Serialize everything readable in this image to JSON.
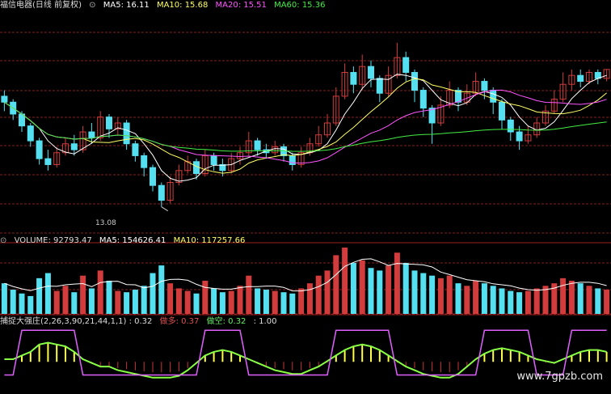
{
  "colors": {
    "background": "#000000",
    "up": "#d23c3c",
    "down": "#54e0f0",
    "grid": "#8a1e1e",
    "ma5": "#ffffff",
    "ma10": "#ffff66",
    "ma20": "#ff55ff",
    "ma60": "#44ee44",
    "ind_line": "#e060ff",
    "ind_bar_up": "#ffff44",
    "ind_bar_dn": "#cc3333",
    "ind_curve": "#88ff44"
  },
  "price_panel": {
    "title": "福信电器(日线 前复权)",
    "icon": "circle-settings-icon",
    "ma5": "MA5: 16.11",
    "ma10": "MA10: 15.68",
    "ma20": "MA20: 15.51",
    "ma60": "MA60: 15.36",
    "low_label": "13.08"
  },
  "volume_panel": {
    "volume": "VOLUME: 92793.47",
    "ma5": "MA5: 154626.41",
    "ma10": "MA10: 117257.66"
  },
  "indicator_panel": {
    "name": "捕捉大强庄(2,26,3,90,21,44,1,1) : 0.32",
    "long_label": "做多: 0.37",
    "short_label": "做空: 0.32",
    "extra": ": 1.00"
  },
  "watermark": "www.7gpzb.com",
  "chart_data": {
    "type": "candlestick",
    "price_ylim": [
      12.2,
      19.6
    ],
    "volume_ylim": [
      0,
      260000
    ],
    "candles": [
      [
        16.8,
        16.6,
        17.0,
        16.3
      ],
      [
        16.6,
        16.2,
        16.7,
        16.0
      ],
      [
        16.2,
        15.8,
        16.3,
        15.6
      ],
      [
        15.8,
        15.3,
        15.9,
        15.1
      ],
      [
        15.3,
        14.7,
        15.4,
        14.5
      ],
      [
        14.7,
        14.5,
        15.0,
        14.3
      ],
      [
        14.5,
        14.9,
        15.1,
        14.4
      ],
      [
        14.9,
        15.2,
        15.4,
        14.8
      ],
      [
        15.2,
        15.0,
        15.5,
        14.8
      ],
      [
        15.0,
        15.6,
        15.8,
        14.9
      ],
      [
        15.6,
        15.4,
        15.9,
        15.2
      ],
      [
        15.4,
        16.1,
        16.3,
        15.3
      ],
      [
        16.1,
        15.7,
        16.2,
        15.4
      ],
      [
        15.7,
        15.9,
        16.1,
        15.5
      ],
      [
        15.9,
        15.2,
        16.0,
        15.0
      ],
      [
        15.2,
        14.8,
        15.3,
        14.6
      ],
      [
        14.8,
        14.4,
        14.9,
        14.1
      ],
      [
        14.4,
        13.8,
        14.5,
        13.6
      ],
      [
        13.8,
        13.3,
        13.9,
        13.08
      ],
      [
        13.3,
        13.9,
        14.1,
        13.2
      ],
      [
        13.9,
        14.3,
        14.5,
        13.8
      ],
      [
        14.3,
        14.6,
        14.8,
        14.2
      ],
      [
        14.6,
        14.2,
        14.7,
        14.0
      ],
      [
        14.2,
        14.8,
        15.0,
        14.1
      ],
      [
        14.8,
        14.5,
        14.9,
        14.3
      ],
      [
        14.5,
        14.3,
        14.7,
        14.1
      ],
      [
        14.3,
        14.7,
        14.9,
        14.2
      ],
      [
        14.7,
        14.9,
        15.1,
        14.5
      ],
      [
        14.9,
        15.3,
        15.6,
        14.8
      ],
      [
        15.3,
        15.0,
        15.4,
        14.8
      ],
      [
        15.0,
        14.9,
        15.2,
        14.7
      ],
      [
        14.9,
        15.1,
        15.3,
        14.8
      ],
      [
        15.1,
        14.8,
        15.2,
        14.6
      ],
      [
        14.8,
        14.5,
        14.9,
        14.3
      ],
      [
        14.5,
        14.9,
        15.1,
        14.4
      ],
      [
        14.9,
        15.2,
        15.4,
        14.8
      ],
      [
        15.2,
        15.5,
        15.8,
        15.1
      ],
      [
        15.5,
        15.9,
        16.2,
        15.4
      ],
      [
        15.9,
        16.8,
        17.1,
        15.8
      ],
      [
        16.8,
        17.6,
        17.9,
        16.7
      ],
      [
        17.6,
        17.2,
        17.8,
        16.9
      ],
      [
        17.2,
        17.8,
        18.2,
        17.0
      ],
      [
        17.8,
        17.4,
        18.0,
        17.1
      ],
      [
        17.4,
        16.9,
        17.5,
        16.6
      ],
      [
        16.9,
        17.5,
        17.8,
        16.8
      ],
      [
        17.5,
        18.1,
        18.6,
        17.4
      ],
      [
        18.1,
        17.6,
        18.3,
        17.3
      ],
      [
        17.6,
        17.0,
        17.7,
        16.6
      ],
      [
        17.0,
        16.4,
        17.1,
        16.1
      ],
      [
        16.4,
        15.9,
        16.5,
        15.2
      ],
      [
        15.9,
        16.5,
        16.8,
        15.8
      ],
      [
        16.5,
        17.0,
        17.3,
        16.4
      ],
      [
        17.0,
        16.6,
        17.1,
        16.3
      ],
      [
        16.6,
        16.9,
        17.2,
        16.5
      ],
      [
        16.9,
        17.3,
        17.6,
        16.8
      ],
      [
        17.3,
        17.0,
        17.4,
        16.7
      ],
      [
        17.0,
        16.6,
        17.1,
        16.2
      ],
      [
        16.6,
        16.0,
        16.7,
        15.7
      ],
      [
        16.0,
        15.6,
        16.1,
        15.3
      ],
      [
        15.6,
        15.3,
        15.8,
        15.0
      ],
      [
        15.3,
        15.5,
        15.8,
        15.2
      ],
      [
        15.5,
        15.9,
        16.1,
        15.4
      ],
      [
        15.9,
        16.3,
        16.5,
        15.8
      ],
      [
        16.3,
        16.7,
        17.0,
        16.2
      ],
      [
        16.7,
        17.2,
        17.6,
        16.6
      ],
      [
        17.2,
        17.5,
        17.7,
        17.0
      ],
      [
        17.5,
        17.3,
        17.7,
        17.1
      ],
      [
        17.3,
        17.6,
        17.7,
        17.2
      ],
      [
        17.6,
        17.4,
        17.7,
        17.2
      ],
      [
        17.4,
        17.7,
        17.7,
        17.3
      ]
    ],
    "volume": [
      120,
      95,
      80,
      70,
      140,
      160,
      90,
      110,
      85,
      150,
      100,
      170,
      130,
      90,
      85,
      95,
      110,
      160,
      190,
      120,
      100,
      90,
      80,
      130,
      100,
      85,
      90,
      110,
      150,
      100,
      95,
      90,
      85,
      80,
      100,
      120,
      150,
      170,
      230,
      260,
      200,
      210,
      180,
      170,
      190,
      240,
      200,
      170,
      160,
      150,
      140,
      150,
      120,
      110,
      130,
      120,
      110,
      100,
      90,
      85,
      90,
      100,
      110,
      120,
      140,
      130,
      120,
      110,
      100,
      95
    ],
    "indicator": {
      "range": [
        0,
        1
      ],
      "values": [
        0.5,
        0.5,
        0.6,
        0.7,
        0.9,
        0.95,
        0.9,
        0.85,
        0.7,
        0.5,
        0.4,
        0.3,
        0.3,
        0.2,
        0.15,
        0.1,
        0.05,
        0.0,
        0.0,
        0.0,
        0.05,
        0.2,
        0.4,
        0.6,
        0.7,
        0.75,
        0.7,
        0.6,
        0.5,
        0.4,
        0.3,
        0.2,
        0.15,
        0.1,
        0.1,
        0.2,
        0.3,
        0.45,
        0.6,
        0.75,
        0.85,
        0.9,
        0.85,
        0.75,
        0.6,
        0.45,
        0.3,
        0.2,
        0.1,
        0.05,
        0.0,
        0.0,
        0.1,
        0.3,
        0.5,
        0.65,
        0.75,
        0.8,
        0.75,
        0.7,
        0.6,
        0.5,
        0.45,
        0.4,
        0.5,
        0.6,
        0.7,
        0.75,
        0.75,
        0.7
      ]
    }
  }
}
